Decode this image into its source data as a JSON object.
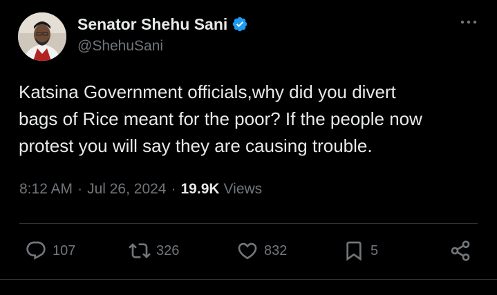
{
  "author": {
    "display_name": "Senator Shehu Sani",
    "handle": "@ShehuSani",
    "verified_color": "#1d9bf0"
  },
  "tweet": {
    "line1": "Katsina Government officials,why did you divert",
    "line2": "bags of Rice meant for the poor? If the people now",
    "line3": "protest you will say they are causing trouble."
  },
  "meta": {
    "time": "8:12 AM",
    "separator": "·",
    "date": "Jul 26, 2024",
    "views_count": "19.9K",
    "views_label": "Views"
  },
  "actions": {
    "reply_count": "107",
    "repost_count": "326",
    "like_count": "832",
    "bookmark_count": "5"
  },
  "icons": [
    "more-icon",
    "verified-icon",
    "reply-icon",
    "repost-icon",
    "like-icon",
    "bookmark-icon",
    "share-icon"
  ],
  "colors": {
    "background": "#000000",
    "text": "#e7e9ea",
    "muted": "#71767b",
    "border": "#2f3336"
  }
}
